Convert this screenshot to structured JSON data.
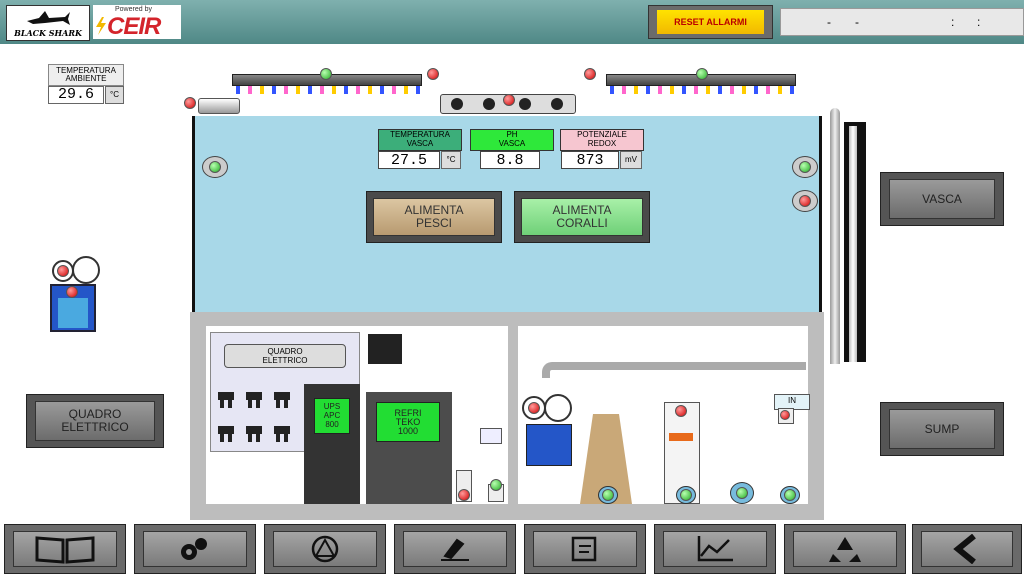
{
  "header": {
    "logo_text": "BLACK SHARK",
    "ceir_powered": "Powered by",
    "ceir_name": "CEIR",
    "reset_label": "RESET ALLARMI",
    "date_sep1": "-",
    "date_sep2": "-",
    "time_sep1": ":",
    "time_sep2": ":"
  },
  "ambient": {
    "label_line1": "TEMPERATURA",
    "label_line2": "AMBIENTE",
    "value": "29.6",
    "unit": "°C"
  },
  "tank": {
    "temp_label1": "TEMPERATURA",
    "temp_label2": "VASCA",
    "temp_value": "27.5",
    "temp_unit": "°C",
    "ph_label1": "PH",
    "ph_label2": "VASCA",
    "ph_value": "8.8",
    "redox_label1": "POTENZIALE",
    "redox_label2": "REDOX",
    "redox_value": "873",
    "redox_unit": "mV",
    "feed_fish1": "ALIMENTA",
    "feed_fish2": "PESCI",
    "feed_coral1": "ALIMENTA",
    "feed_coral2": "CORALLI"
  },
  "cabinet": {
    "panel_label1": "QUADRO",
    "panel_label2": "ELETTRICO",
    "ups1": "UPS",
    "ups2": "APC",
    "ups3": "800",
    "chiller1": "REFRI",
    "chiller2": "TEKO",
    "chiller3": "1000",
    "in_label": "IN"
  },
  "side_buttons": {
    "vasca": "VASCA",
    "sump": "SUMP",
    "quadro1": "QUADRO",
    "quadro2": "ELETTRICO"
  },
  "colors": {
    "tank_water": "#a8d8e8",
    "topbar": "#5e9896",
    "reset_yellow": "#ffe300",
    "feed_fish": "#c9b08a",
    "feed_coral": "#88e890",
    "led_green": "#22aa22",
    "led_red": "#d00000"
  },
  "nav": {
    "icons": [
      "book-icon",
      "gears-icon",
      "alarm-icon",
      "hand-writing-icon",
      "note-edit-icon",
      "trend-chart-icon",
      "recycle-icon",
      "back-arrow-icon"
    ]
  }
}
